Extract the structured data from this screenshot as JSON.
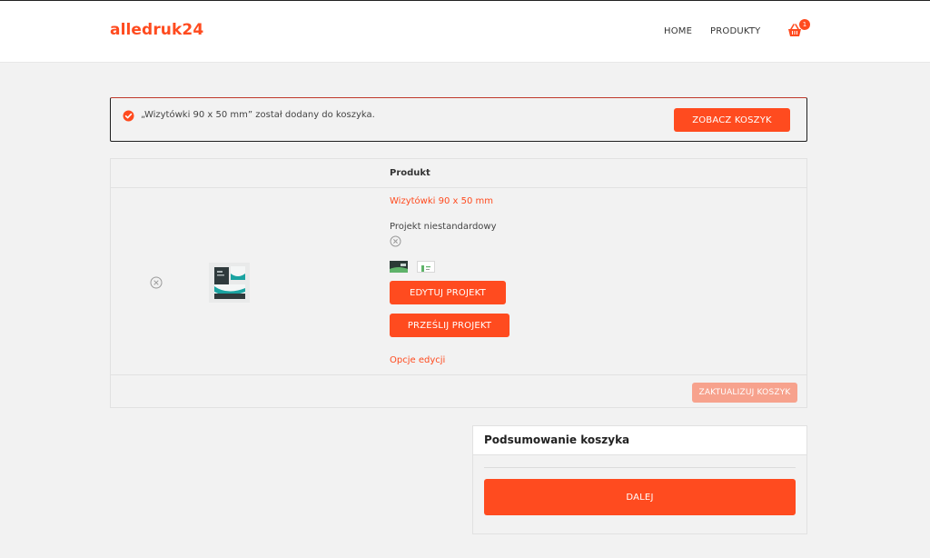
{
  "header": {
    "logo": "alledruk24",
    "nav": {
      "home": "HOME",
      "products": "PRODUKTY"
    },
    "cart_count": "1"
  },
  "notice": {
    "message": "„Wizytówki 90 x 50 mm” został dodany do koszyka.",
    "view_cart_label": "ZOBACZ KOSZYK"
  },
  "cart": {
    "column_product": "Produkt",
    "item": {
      "name": "Wizytówki 90 x 50 mm",
      "project_type": "Projekt niestandardowy",
      "edit_button": "EDYTUJ PROJEKT",
      "upload_button": "PRZEŚLIJ PROJEKT",
      "edit_options": "Opcje edycji"
    },
    "update_button": "ZAKTUALIZUJ KOSZYK"
  },
  "summary": {
    "title": "Podsumowanie koszyka",
    "next_button": "DALEJ"
  },
  "colors": {
    "accent": "#ff4b1f",
    "accent_disabled": "#f7a28d",
    "background": "#f2f2f2"
  },
  "icons": {
    "cart": "basket-icon",
    "success": "check-circle-icon",
    "remove": "remove-circle-icon"
  }
}
